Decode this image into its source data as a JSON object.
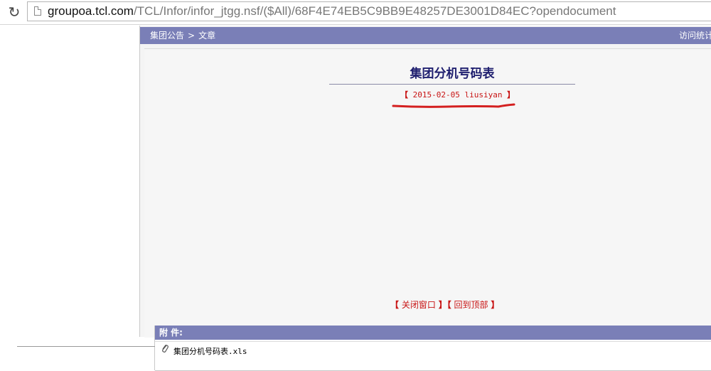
{
  "browser": {
    "url_host": "groupoa.tcl.com",
    "url_path": "/TCL/Infor/infor_jtgg.nsf/($All)/68F4E74EB5C9BB9E48257DE3001D84EC?opendocument",
    "reload_icon": "reload-icon",
    "page_icon": "page-icon"
  },
  "navbar": {
    "crumb_1": "集团公告",
    "separator": ">",
    "crumb_2": "文章",
    "visit_stats": "访问统计"
  },
  "article": {
    "title": "集团分机号码表",
    "bracket_left": "【",
    "meta": "2015-02-05 liusiyan",
    "bracket_right": "】"
  },
  "actions": {
    "close_label": "关闭窗口",
    "top_label": "回到顶部",
    "bracket_left": "【",
    "bracket_right": "】"
  },
  "attachments": {
    "header": "附  件:",
    "files": [
      "集团分机号码表.xls"
    ]
  },
  "colors": {
    "nav_bar": "#7a7fb7",
    "title": "#1f1f6f",
    "accent_red": "#c81414"
  }
}
